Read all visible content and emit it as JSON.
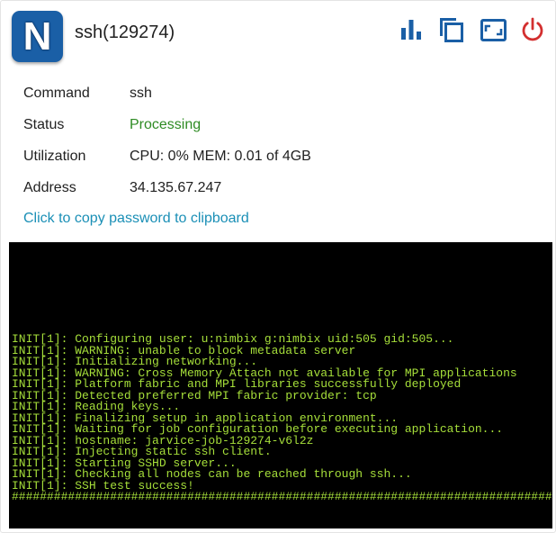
{
  "header": {
    "logo_letter": "N",
    "title": "ssh(129274)"
  },
  "toolbar": {
    "icons": [
      "bar-chart-icon",
      "copy-icon",
      "aspect-ratio-icon",
      "power-icon"
    ],
    "accent_color": "#1a5fa6",
    "power_color": "#d32f2f"
  },
  "info": {
    "command_label": "Command",
    "command_value": "ssh",
    "status_label": "Status",
    "status_value": "Processing",
    "utilization_label": "Utilization",
    "utilization_value": "CPU: 0% MEM: 0.01 of 4GB",
    "address_label": "Address",
    "address_value": "34.135.67.247"
  },
  "copy_password_link": "Click to copy password to clipboard",
  "terminal": {
    "text_color": "#a6df3a",
    "lines": [
      "INIT[1]: Configuring user: u:nimbix g:nimbix uid:505 gid:505...",
      "INIT[1]: WARNING: unable to block metadata server",
      "INIT[1]: Initializing networking...",
      "INIT[1]: WARNING: Cross Memory Attach not available for MPI applications",
      "INIT[1]: Platform fabric and MPI libraries successfully deployed",
      "INIT[1]: Detected preferred MPI fabric provider: tcp",
      "INIT[1]: Reading keys...",
      "INIT[1]: Finalizing setup in application environment...",
      "INIT[1]: Waiting for job configuration before executing application...",
      "INIT[1]: hostname: jarvice-job-129274-v6l2z",
      "INIT[1]: Injecting static ssh client.",
      "INIT[1]: Starting SSHD server...",
      "INIT[1]: Checking all nodes can be reached through ssh...",
      "INIT[1]: SSH test success!",
      "################################################################################"
    ]
  }
}
